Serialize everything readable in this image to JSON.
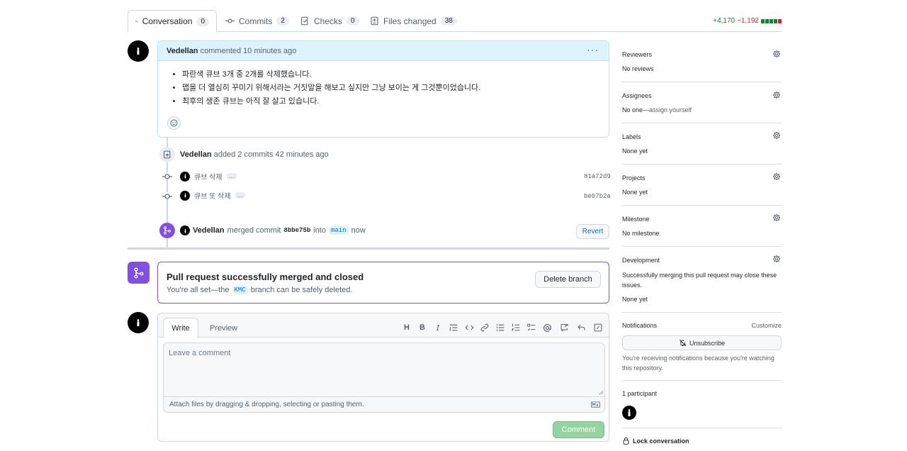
{
  "tabs": [
    {
      "label": "Conversation",
      "count": "0"
    },
    {
      "label": "Commits",
      "count": "2"
    },
    {
      "label": "Checks",
      "count": "0"
    },
    {
      "label": "Files changed",
      "count": "38"
    }
  ],
  "diffstat": {
    "additions": "+4,170",
    "deletions": "−1,192"
  },
  "comment": {
    "author": "Vedellan",
    "meta": "commented 10 minutes ago",
    "items": [
      "파란색 큐브 3개 중 2개를 삭제했습니다.",
      "맵을 더 열심히 꾸미기 위해서라는 거짓말을 해보고 싶지만 그냥 보이는 게 그것뿐이었습니다.",
      "최후의 생존 큐브는 아직 잘 살고 있습니다."
    ]
  },
  "commits_event": {
    "author": "Vedellan",
    "text": "added 2 commits 42 minutes ago"
  },
  "commits": [
    {
      "message": "큐브 삭제",
      "sha": "81a72d9"
    },
    {
      "message": "큐브 또 삭제",
      "sha": "be07b2a"
    }
  ],
  "merge_event": {
    "author": "Vedellan",
    "text1": "merged commit",
    "commit": "8bbe75b",
    "text2": "into",
    "branch": "main",
    "text3": "now",
    "revert": "Revert"
  },
  "merged_box": {
    "title": "Pull request successfully merged and closed",
    "sub1": "You're all set—the",
    "branch": "KMC",
    "sub2": "branch can be safely deleted.",
    "button": "Delete branch"
  },
  "composer": {
    "write": "Write",
    "preview": "Preview",
    "placeholder": "Leave a comment",
    "attach": "Attach files by dragging & dropping, selecting or pasting them.",
    "submit": "Comment"
  },
  "sidebar": {
    "reviewers": {
      "label": "Reviewers",
      "value": "No reviews"
    },
    "assignees": {
      "label": "Assignees",
      "value": "No one—",
      "link": "assign yourself"
    },
    "labels": {
      "label": "Labels",
      "value": "None yet"
    },
    "projects": {
      "label": "Projects",
      "value": "None yet"
    },
    "milestone": {
      "label": "Milestone",
      "value": "No milestone"
    },
    "development": {
      "label": "Development",
      "text": "Successfully merging this pull request may close these issues.",
      "value": "None yet"
    },
    "notifications": {
      "label": "Notifications",
      "customize": "Customize",
      "button": "Unsubscribe",
      "note": "You're receiving notifications because you're watching this repository."
    },
    "participants": {
      "label": "1 participant"
    },
    "lock": {
      "label": "Lock conversation"
    }
  },
  "colors": {
    "accent": "#0969da",
    "merged": "#8250df",
    "success": "#1a7f37",
    "danger": "#cf222e"
  }
}
